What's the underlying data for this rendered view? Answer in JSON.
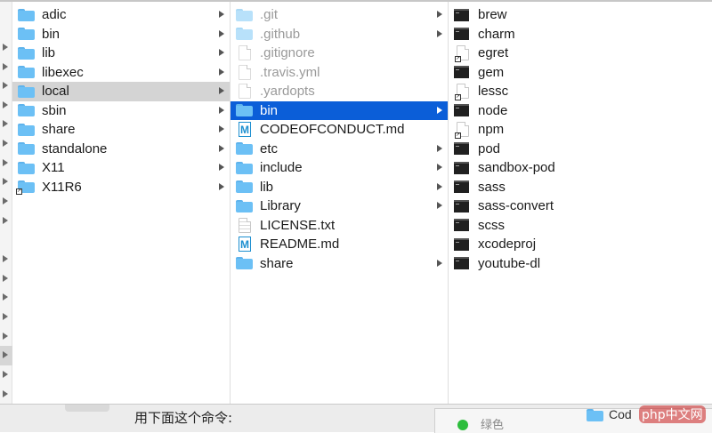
{
  "column1": [
    {
      "label": "adic",
      "type": "folder",
      "chevron": true
    },
    {
      "label": "bin",
      "type": "folder",
      "chevron": true
    },
    {
      "label": "lib",
      "type": "folder",
      "chevron": true
    },
    {
      "label": "libexec",
      "type": "folder",
      "chevron": true
    },
    {
      "label": "local",
      "type": "folder",
      "chevron": true,
      "selected": "gray"
    },
    {
      "label": "sbin",
      "type": "folder",
      "chevron": true
    },
    {
      "label": "share",
      "type": "folder",
      "chevron": true
    },
    {
      "label": "standalone",
      "type": "folder",
      "chevron": true
    },
    {
      "label": "X11",
      "type": "folder",
      "chevron": true
    },
    {
      "label": "X11R6",
      "type": "folder-alias",
      "chevron": true
    }
  ],
  "column2": [
    {
      "label": ".git",
      "type": "folder",
      "dim": true,
      "chevron": true
    },
    {
      "label": ".github",
      "type": "folder",
      "dim": true,
      "chevron": true
    },
    {
      "label": ".gitignore",
      "type": "doc",
      "dim": true
    },
    {
      "label": ".travis.yml",
      "type": "doc",
      "dim": true
    },
    {
      "label": ".yardopts",
      "type": "doc",
      "dim": true
    },
    {
      "label": "bin",
      "type": "folder",
      "chevron": true,
      "selected": "blue"
    },
    {
      "label": "CODEOFCONDUCT.md",
      "type": "md"
    },
    {
      "label": "etc",
      "type": "folder",
      "chevron": true
    },
    {
      "label": "include",
      "type": "folder",
      "chevron": true
    },
    {
      "label": "lib",
      "type": "folder",
      "chevron": true
    },
    {
      "label": "Library",
      "type": "folder",
      "chevron": true
    },
    {
      "label": "LICENSE.txt",
      "type": "txt"
    },
    {
      "label": "README.md",
      "type": "md"
    },
    {
      "label": "share",
      "type": "folder",
      "chevron": true
    }
  ],
  "column3": [
    {
      "label": "brew",
      "type": "term"
    },
    {
      "label": "charm",
      "type": "term"
    },
    {
      "label": "egret",
      "type": "doc-alias"
    },
    {
      "label": "gem",
      "type": "term"
    },
    {
      "label": "lessc",
      "type": "doc-alias"
    },
    {
      "label": "node",
      "type": "term"
    },
    {
      "label": "npm",
      "type": "doc-alias"
    },
    {
      "label": "pod",
      "type": "term"
    },
    {
      "label": "sandbox-pod",
      "type": "term"
    },
    {
      "label": "sass",
      "type": "term"
    },
    {
      "label": "sass-convert",
      "type": "term"
    },
    {
      "label": "scss",
      "type": "term"
    },
    {
      "label": "xcodeproj",
      "type": "term"
    },
    {
      "label": "youtube-dl",
      "type": "term"
    }
  ],
  "md_glyph": "M",
  "bottom": {
    "caption": "用下面这个命令:",
    "status_text": "绿色",
    "folder_label": "Cod",
    "watermark": "php中文网"
  },
  "colors": {
    "selection_blue": "#0b5ed8",
    "selection_gray": "#d4d4d4",
    "folder_blue": "#6cc0f5"
  }
}
